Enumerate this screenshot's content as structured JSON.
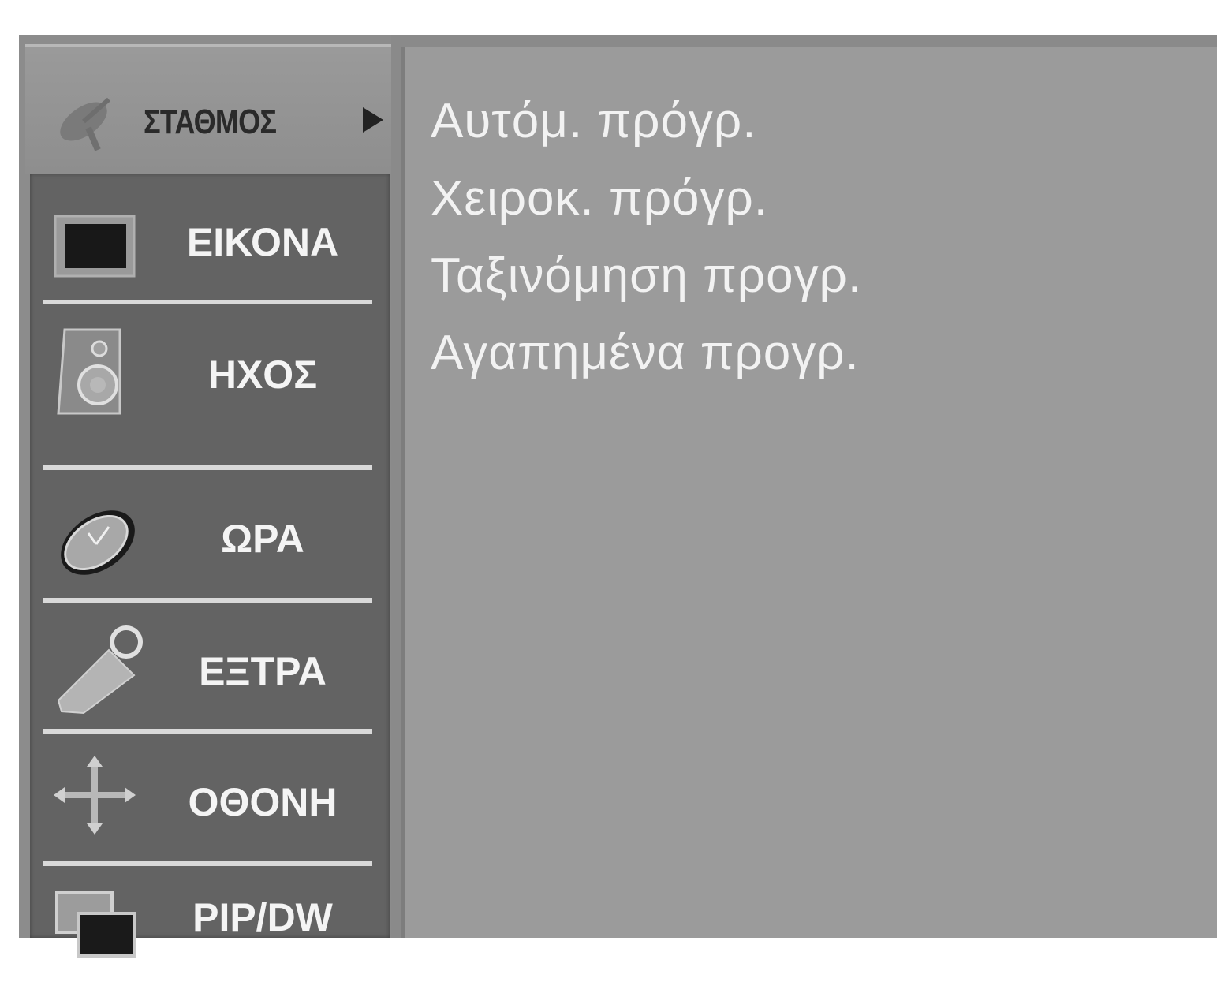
{
  "active_tab": {
    "label": "ΣΤΑΘΜΟΣ",
    "icon": "satellite-dish-icon"
  },
  "menu": {
    "items": [
      {
        "label": "ΕΙΚΟΝΑ",
        "icon": "picture-icon"
      },
      {
        "label": "ΗΧΟΣ",
        "icon": "speaker-icon"
      },
      {
        "label": "ΩΡΑ",
        "icon": "clock-icon"
      },
      {
        "label": "ΕΞΤΡΑ",
        "icon": "key-tag-icon"
      },
      {
        "label": "ΟΘΟΝΗ",
        "icon": "move-arrows-icon"
      },
      {
        "label": "PIP/DW",
        "icon": "pip-windows-icon"
      }
    ]
  },
  "submenu": {
    "items": [
      "Αυτόμ. πρόγρ.",
      "Χειροκ. πρόγρ.",
      "Ταξινόμηση προγρ.",
      "Αγαπημένα προγρ."
    ]
  },
  "colors": {
    "panel_dark": "#636363",
    "panel_light": "#9b9b9b",
    "text_light": "#f2f2f2"
  }
}
